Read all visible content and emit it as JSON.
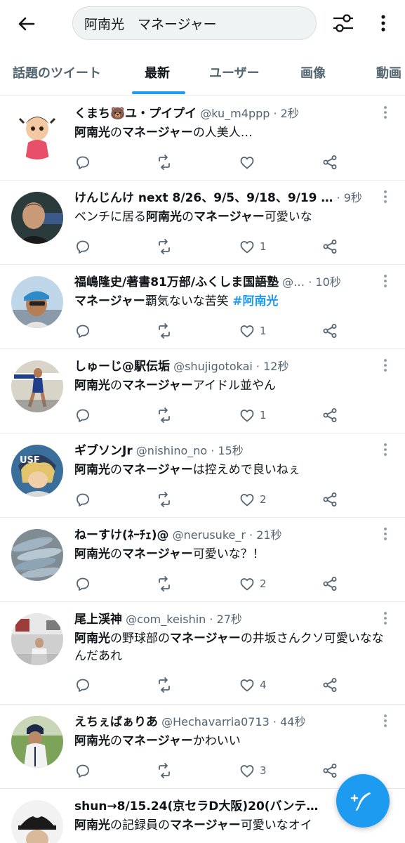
{
  "search": {
    "query": "阿南光　マネージャー"
  },
  "tabs": [
    {
      "label": "話題のツイート"
    },
    {
      "label": "最新"
    },
    {
      "label": "ユーザー"
    },
    {
      "label": "画像"
    },
    {
      "label": "動画"
    }
  ],
  "active_tab": "最新",
  "colors": {
    "accent": "#1d9bf0",
    "text": "#0f1419",
    "secondary": "#536471"
  },
  "tweets": [
    {
      "name": "くまち🐻ユ・プイプイ",
      "handle": "@ku_m4ppp",
      "time": "2秒",
      "body": [
        {
          "t": "阿南光",
          "b": true
        },
        {
          "t": "の",
          "b": false
        },
        {
          "t": "マネージャー",
          "b": true
        },
        {
          "t": "の人美人…",
          "b": false
        }
      ],
      "likes": "",
      "avatar": "doll-avatar"
    },
    {
      "name": "けんじんけ next 8/26、9/5、9/18、9/19 …",
      "handle": "",
      "time": "9秒",
      "body": [
        {
          "t": "ベンチに居る",
          "b": false
        },
        {
          "t": "阿南光",
          "b": true
        },
        {
          "t": "の",
          "b": false
        },
        {
          "t": "マネージャー",
          "b": true
        },
        {
          "t": "可愛いな",
          "b": false
        }
      ],
      "likes": "1",
      "avatar": "player-avatar"
    },
    {
      "name": "福嶋隆史/著書81万部/ふくしま国語塾",
      "handle": "@…",
      "time": "10秒",
      "body": [
        {
          "t": "マネージャー",
          "b": true
        },
        {
          "t": "覇気ないな苦笑 ",
          "b": false
        },
        {
          "t": "#阿南光",
          "b": true,
          "tag": true
        }
      ],
      "likes": "1",
      "avatar": "runner-avatar"
    },
    {
      "name": "しゅーじ@駅伝垢",
      "handle": "@shujigotokai",
      "time": "12秒",
      "body": [
        {
          "t": "阿南光",
          "b": true
        },
        {
          "t": "の",
          "b": false
        },
        {
          "t": "マネージャー",
          "b": true
        },
        {
          "t": "アイドル並やん",
          "b": false
        }
      ],
      "likes": "1",
      "avatar": "ekiden-avatar"
    },
    {
      "name": "ギブソンJr",
      "handle": "@nishino_no",
      "time": "15秒",
      "body": [
        {
          "t": "阿南光",
          "b": true
        },
        {
          "t": "の",
          "b": false
        },
        {
          "t": "マネージャー",
          "b": true
        },
        {
          "t": "は控えめで良いねぇ",
          "b": false
        }
      ],
      "likes": "2",
      "avatar": "anime-avatar"
    },
    {
      "name": "ねーすけ(ﾈｰﾁｪ)@",
      "handle": "@nerusuke_r",
      "time": "21秒",
      "body": [
        {
          "t": "阿南光",
          "b": true
        },
        {
          "t": "の",
          "b": false
        },
        {
          "t": "マネージャー",
          "b": true
        },
        {
          "t": "可愛いな？！",
          "b": false
        }
      ],
      "likes": "2",
      "avatar": "fish-avatar"
    },
    {
      "name": "尾上渓神",
      "handle": "@com_keishin",
      "time": "27秒",
      "body": [
        {
          "t": "阿南光",
          "b": true
        },
        {
          "t": "の野球部の",
          "b": false
        },
        {
          "t": "マネージャー",
          "b": true
        },
        {
          "t": "の井坂さんクソ可愛いななんだあれ",
          "b": false
        }
      ],
      "likes": "4",
      "avatar": "street-avatar"
    },
    {
      "name": "えちぇばぁりあ",
      "handle": "@Hechavarria0713",
      "time": "44秒",
      "body": [
        {
          "t": "阿南光",
          "b": true
        },
        {
          "t": "の",
          "b": false
        },
        {
          "t": "マネージャー",
          "b": true
        },
        {
          "t": "かわいい",
          "b": false
        }
      ],
      "likes": "3",
      "avatar": "batter-avatar"
    },
    {
      "name": "shun→8/15.24(京セラD大阪)20(バンテ…",
      "handle": "",
      "time": "",
      "body": [
        {
          "t": "阿南光",
          "b": true
        },
        {
          "t": "の記録員の",
          "b": false
        },
        {
          "t": "マネージャー",
          "b": true
        },
        {
          "t": "可愛いなオイ",
          "b": false
        }
      ],
      "likes": "",
      "avatar": "cap-avatar"
    }
  ]
}
